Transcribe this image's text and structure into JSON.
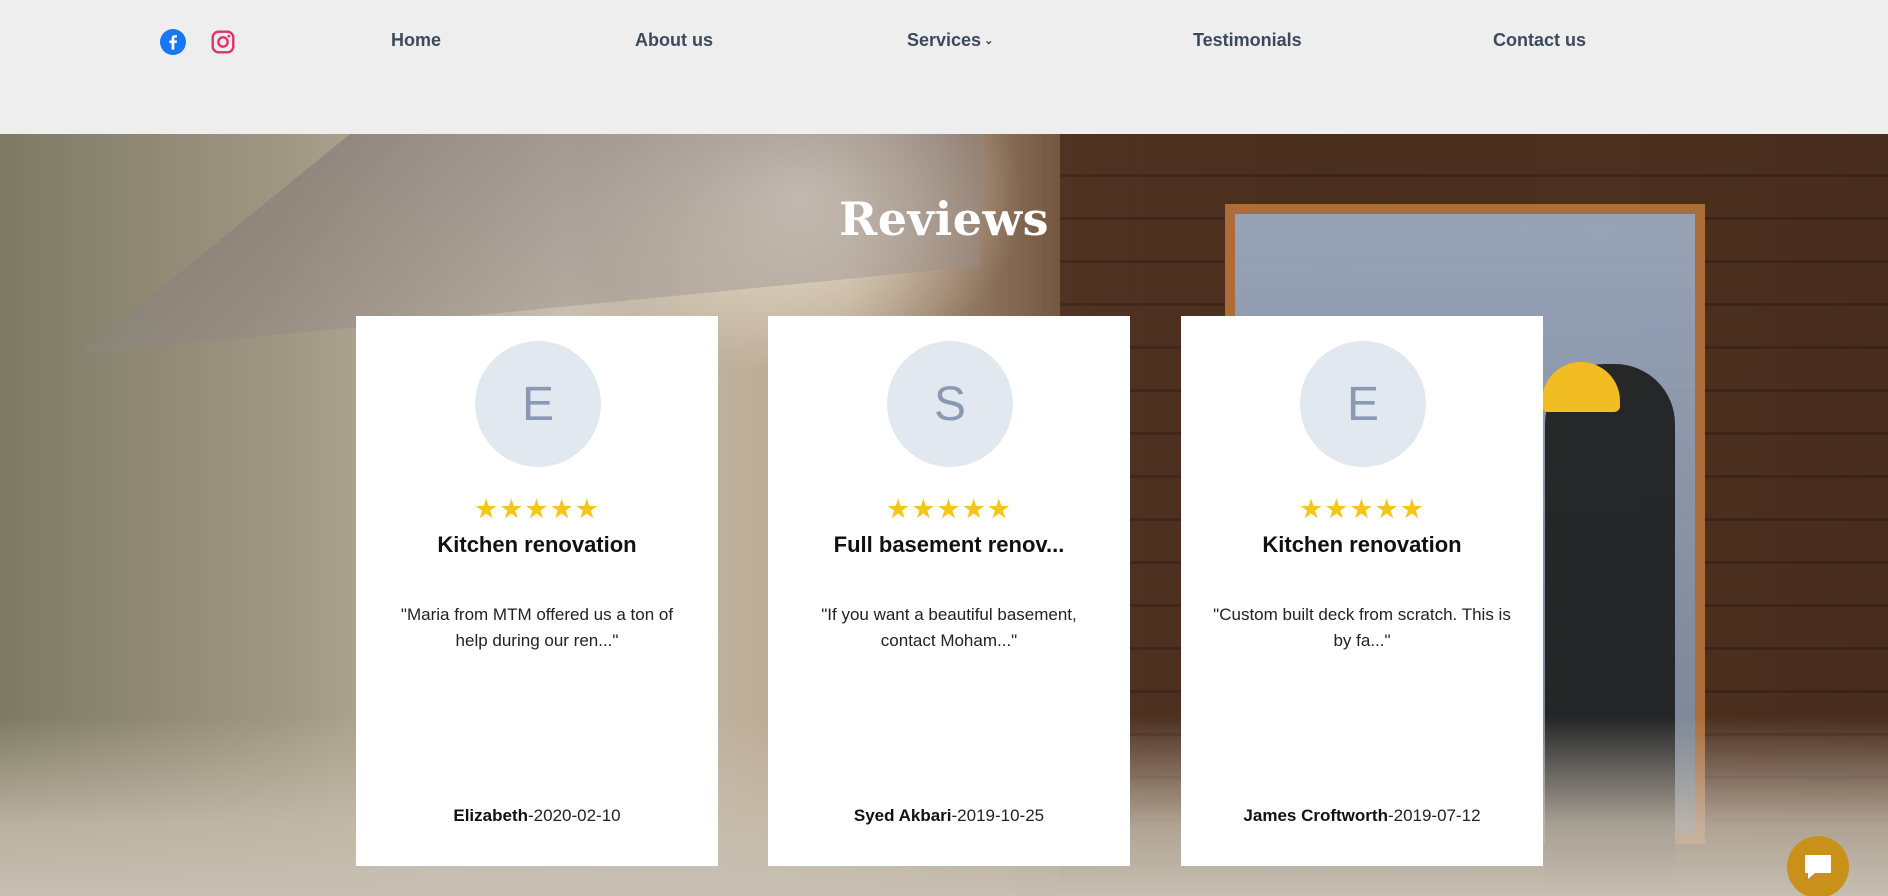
{
  "nav": {
    "items": [
      {
        "label": "Home"
      },
      {
        "label": "About us"
      },
      {
        "label": "Services",
        "has_dropdown": true
      },
      {
        "label": "Testimonials"
      },
      {
        "label": "Contact us"
      }
    ],
    "social": [
      {
        "icon": "facebook-icon",
        "color": "#1877f2"
      },
      {
        "icon": "instagram-icon",
        "color": "#e1306c"
      }
    ]
  },
  "section": {
    "title": "Reviews"
  },
  "reviews": [
    {
      "initial": "E",
      "rating": 5,
      "stars": "★★★★★",
      "title": "Kitchen renovation",
      "quote": "\"Maria from MTM offered us a ton of help during our ren...\"",
      "author": "Elizabeth",
      "date": "-2020-02-10"
    },
    {
      "initial": "S",
      "rating": 5,
      "stars": "★★★★★",
      "title": "Full basement renov...",
      "quote": "\"If you want a beautiful basement, contact Moham...\"",
      "author": "Syed Akbari",
      "date": "-2019-10-25"
    },
    {
      "initial": "E",
      "rating": 5,
      "stars": "★★★★★",
      "title": "Kitchen renovation",
      "quote": "\"Custom built deck from scratch. This is by fa...\"",
      "author": "James Croftworth",
      "date": "-2019-07-12"
    }
  ],
  "colors": {
    "accent_star": "#f5c518",
    "avatar_bg": "#e2e8f0",
    "chat_button": "#c9901a"
  },
  "chat": {
    "icon": "chat-bubble-icon"
  }
}
